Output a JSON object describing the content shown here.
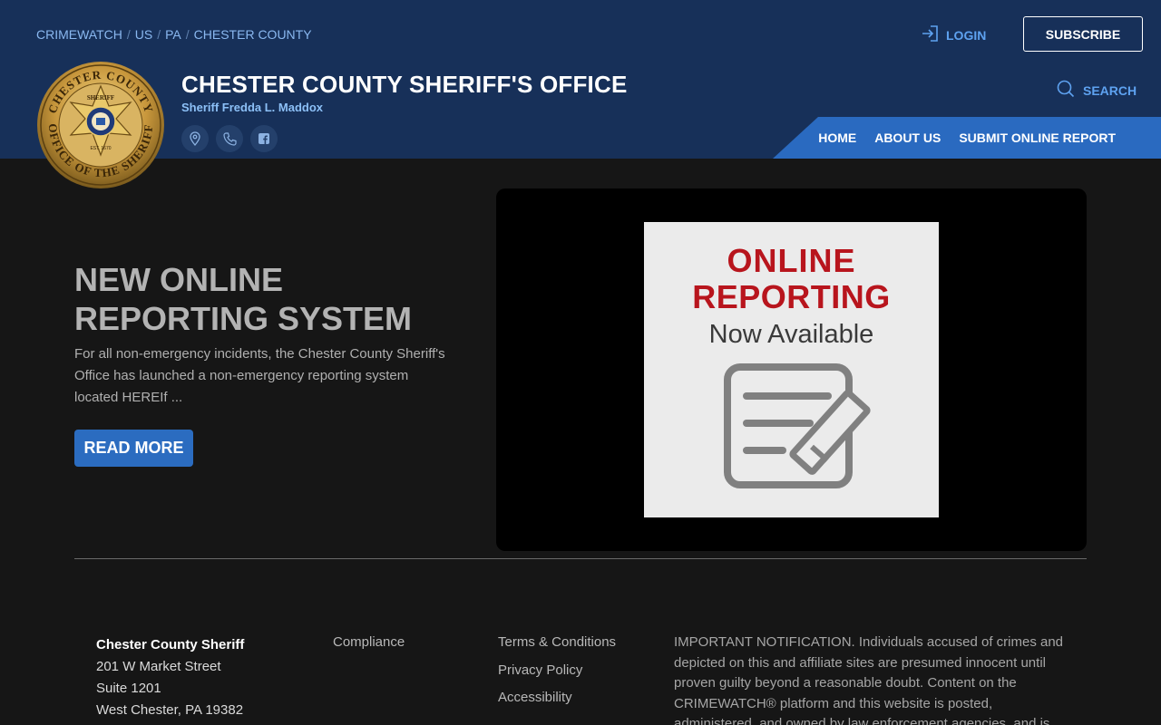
{
  "breadcrumb": [
    "CRIMEWATCH",
    "US",
    "PA",
    "CHESTER COUNTY"
  ],
  "header": {
    "login_label": "LOGIN",
    "subscribe_label": "SUBSCRIBE",
    "title": "CHESTER COUNTY SHERIFF'S OFFICE",
    "subtitle": "Sheriff Fredda L. Maddox",
    "search_label": "SEARCH",
    "seal_text_top": "CHESTER COUNTY",
    "seal_text_bottom": "OFFICE OF THE SHERIFF",
    "seal_star_text": "SHERIFF",
    "seal_est": "EST. 1670"
  },
  "social_icons": [
    "map-pin-icon",
    "phone-icon",
    "facebook-icon"
  ],
  "nav": [
    "HOME",
    "ABOUT US",
    "SUBMIT ONLINE REPORT"
  ],
  "hero": {
    "title": "NEW ONLINE REPORTING SYSTEM",
    "description": "For all non-emergency incidents, the Chester County Sheriff's Office has launched a non-emergency reporting system located HEREIf ...",
    "button_label": "READ MORE",
    "poster_line1": "ONLINE",
    "poster_line2": "REPORTING",
    "poster_line3": "Now Available"
  },
  "footer": {
    "org_name": "Chester County Sheriff",
    "address_line1": "201 W Market Street",
    "address_line2": "Suite 1201",
    "address_line3": "West Chester, PA 19382",
    "compliance": "Compliance",
    "terms": "Terms & Conditions",
    "privacy": "Privacy Policy",
    "accessibility": "Accessibility",
    "notice": "IMPORTANT NOTIFICATION. Individuals accused of crimes and depicted on this and affiliate sites are presumed innocent until proven guilty beyond a reasonable doubt. Content on the CRIMEWATCH® platform and this website is posted, administered, and owned by law enforcement agencies, and is"
  },
  "colors": {
    "header_bg": "#173059",
    "accent_blue": "#2a6ac0",
    "link_blue": "#5ea2f0",
    "page_bg": "#161616"
  }
}
